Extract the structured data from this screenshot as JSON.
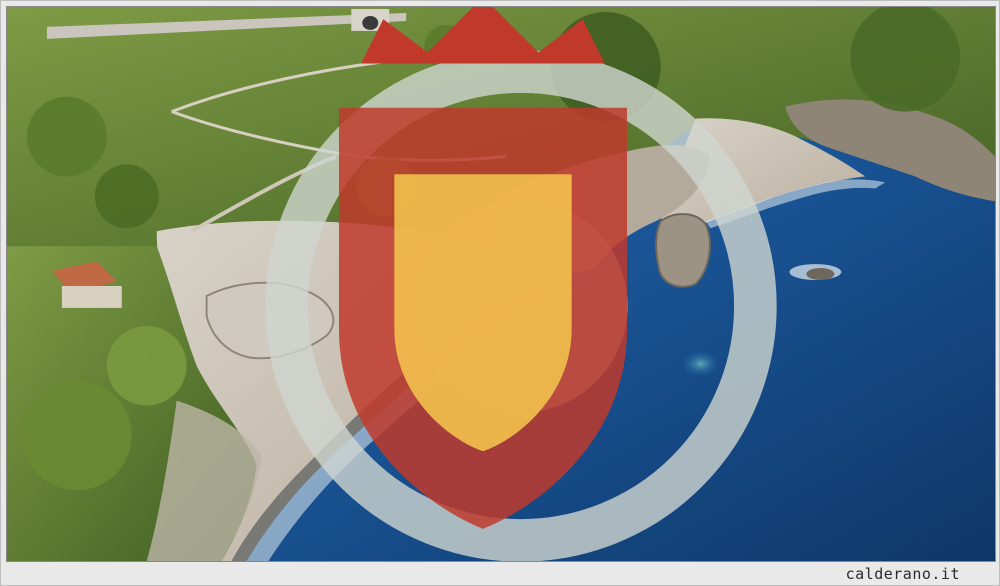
{
  "watermark": {
    "site": "calderano.it",
    "crest_icon": "calderano-crest-icon",
    "corner_logo_icon": "round-badge-icon"
  },
  "colors": {
    "sea_deep": "#0f3d74",
    "sea_mid": "#1e5fa6",
    "sea_shallow": "#3d8fc4",
    "sand": "#c9c0b3",
    "vegetation": "#5e7f2f",
    "rock": "#b8b1a6",
    "frame": "#e9e9e9"
  }
}
